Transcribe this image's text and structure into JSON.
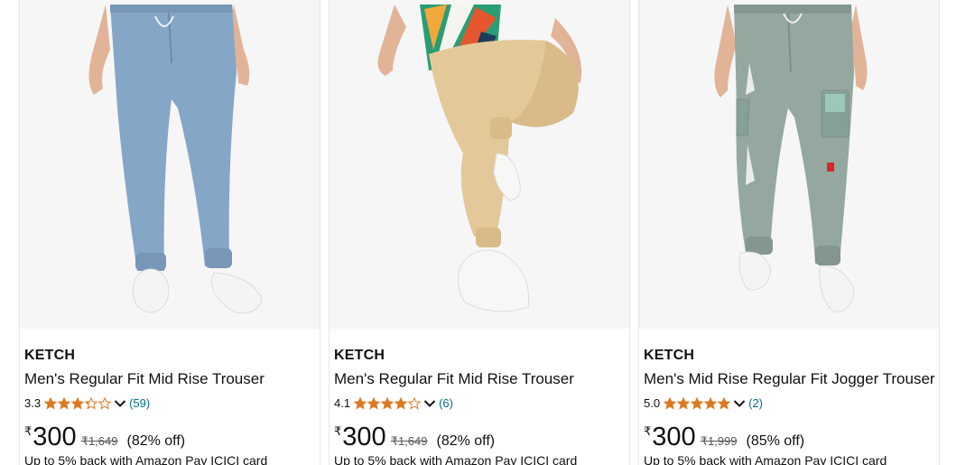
{
  "products": [
    {
      "brand": "KETCH",
      "title": "Men's Regular Fit Mid Rise Trouser",
      "rating": "3.3",
      "rating_value": 3.3,
      "rating_count": "(59)",
      "currency": "₹",
      "price": "300",
      "mrp": "₹1,649",
      "discount": "(82% off)",
      "deal": "Up to 5% back with Amazon Pay ICICI card",
      "colors": {
        "pants": "#86a6c8"
      }
    },
    {
      "brand": "KETCH",
      "title": "Men's Regular Fit Mid Rise Trouser",
      "rating": "4.1",
      "rating_value": 4.1,
      "rating_count": "(6)",
      "currency": "₹",
      "price": "300",
      "mrp": "₹1,649",
      "discount": "(82% off)",
      "deal": "Up to 5% back with Amazon Pay ICICI card",
      "colors": {
        "pants": "#e3c99a"
      }
    },
    {
      "brand": "KETCH",
      "title": "Men's Mid Rise Regular Fit Jogger Trouser",
      "rating": "5.0",
      "rating_value": 5.0,
      "rating_count": "(2)",
      "currency": "₹",
      "price": "300",
      "mrp": "₹1,999",
      "discount": "(85% off)",
      "deal": "Up to 5% back with Amazon Pay ICICI card",
      "colors": {
        "pants": "#94a8a0"
      }
    }
  ],
  "colors": {
    "star": "#de7921",
    "link": "#007185",
    "image_bg": "#f6f6f6"
  }
}
